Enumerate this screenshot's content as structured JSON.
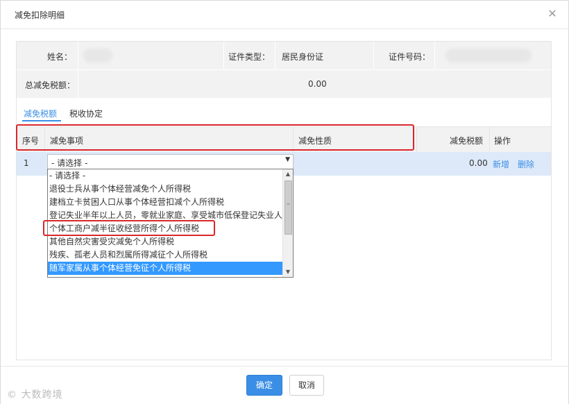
{
  "dialog": {
    "title": "减免扣除明细",
    "close_glyph": "✕"
  },
  "info": {
    "name_label": "姓名：",
    "id_type_label": "证件类型：",
    "id_type_value": "居民身份证",
    "id_number_label": "证件号码：",
    "total_label": "总减免税额：",
    "total_value": "0.00"
  },
  "tabs": [
    {
      "label": "减免税额",
      "active": true
    },
    {
      "label": "税收协定",
      "active": false
    }
  ],
  "table": {
    "columns": [
      "序号",
      "减免事项",
      "减免性质",
      "减免税额",
      "操作"
    ],
    "rows": [
      {
        "index": "1",
        "item": "- 请选择 -",
        "nature": "",
        "amount": "0.00",
        "actions": [
          "新增",
          "删除"
        ]
      }
    ]
  },
  "dropdown": {
    "options": [
      "- 请选择 -",
      "退役士兵从事个体经营减免个人所得税",
      "建档立卡贫困人口从事个体经营扣减个人所得税",
      "登记失业半年以上人员，零就业家庭、享受城市低保登记失业人",
      "个体工商户减半征收经营所得个人所得税",
      "其他自然灾害受灾减免个人所得税",
      "残疾、孤老人员和烈属所得减征个人所得税",
      "随军家属从事个体经营免征个人所得税"
    ],
    "selected_index": 7,
    "highlighted_index": 4,
    "select_arrow": "▼",
    "scroll_up": "▲",
    "scroll_down": "▼"
  },
  "footer": {
    "confirm_label": "确定",
    "cancel_label": "取消"
  },
  "watermark": "© 大数跨境",
  "colors": {
    "accent": "#3a8ee6",
    "highlight_box": "#d9262b",
    "selected_option": "#3399ff",
    "row_selected_bg": "#dde9f9",
    "header_bg": "#f2f2f2"
  }
}
